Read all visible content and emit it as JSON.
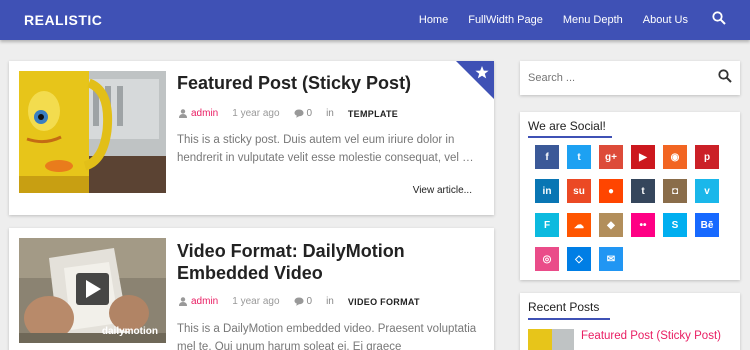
{
  "header": {
    "brand": "REALISTIC",
    "nav": [
      "Home",
      "FullWidth Page",
      "Menu Depth",
      "About Us"
    ]
  },
  "posts": [
    {
      "title": "Featured Post (Sticky Post)",
      "author": "admin",
      "date": "1 year ago",
      "comments": "0",
      "in": "in",
      "category": "TEMPLATE",
      "excerpt": "This is a sticky post. Duis autem vel eum iriure dolor in hendrerit in vulputate velit esse molestie consequat, vel …",
      "readmore": "View article..."
    },
    {
      "title": "Video Format: DailyMotion Embedded Video",
      "author": "admin",
      "date": "1 year ago",
      "comments": "0",
      "in": "in",
      "category": "VIDEO FORMAT",
      "excerpt": "This is a DailyMotion embedded video. Praesent voluptatia mel te. Qui unum harum soleat ei. Ei graece",
      "video_watermark": "dailymotion"
    }
  ],
  "sidebar": {
    "search_placeholder": "Search ...",
    "social_title": "We are Social!",
    "social": [
      {
        "icon": "facebook",
        "glyph": "f",
        "color": "#3b5998"
      },
      {
        "icon": "twitter",
        "glyph": "t",
        "color": "#1da1f2"
      },
      {
        "icon": "google-plus",
        "glyph": "g+",
        "color": "#dd4b39"
      },
      {
        "icon": "youtube",
        "glyph": "▶",
        "color": "#cc181e"
      },
      {
        "icon": "rss",
        "glyph": "◉",
        "color": "#f26522"
      },
      {
        "icon": "pinterest",
        "glyph": "p",
        "color": "#cb2027"
      },
      {
        "icon": "linkedin",
        "glyph": "in",
        "color": "#0976b4"
      },
      {
        "icon": "stumbleupon",
        "glyph": "su",
        "color": "#eb4924"
      },
      {
        "icon": "reddit",
        "glyph": "●",
        "color": "#ff4500"
      },
      {
        "icon": "tumblr",
        "glyph": "t",
        "color": "#35465c"
      },
      {
        "icon": "instagram",
        "glyph": "◘",
        "color": "#8a6d4a"
      },
      {
        "icon": "vimeo",
        "glyph": "v",
        "color": "#1ab7ea"
      },
      {
        "icon": "foursquare",
        "glyph": "F",
        "color": "#0cbadf"
      },
      {
        "icon": "soundcloud",
        "glyph": "☁",
        "color": "#ff5500"
      },
      {
        "icon": "github",
        "glyph": "◆",
        "color": "#b28e5b"
      },
      {
        "icon": "flickr",
        "glyph": "••",
        "color": "#ff0084"
      },
      {
        "icon": "skype",
        "glyph": "S",
        "color": "#00aff0"
      },
      {
        "icon": "behance",
        "glyph": "Bē",
        "color": "#1769ff"
      },
      {
        "icon": "dribbble",
        "glyph": "◎",
        "color": "#ea4c89"
      },
      {
        "icon": "dropbox",
        "glyph": "◇",
        "color": "#007ee5"
      },
      {
        "icon": "email",
        "glyph": "✉",
        "color": "#2196f3"
      }
    ],
    "recent_title": "Recent Posts",
    "recent": [
      {
        "title": "Featured Post (Sticky Post)"
      }
    ]
  },
  "colors": {
    "primary": "#3f51b5",
    "accent": "#e91e63",
    "background": "#eeeeee"
  }
}
